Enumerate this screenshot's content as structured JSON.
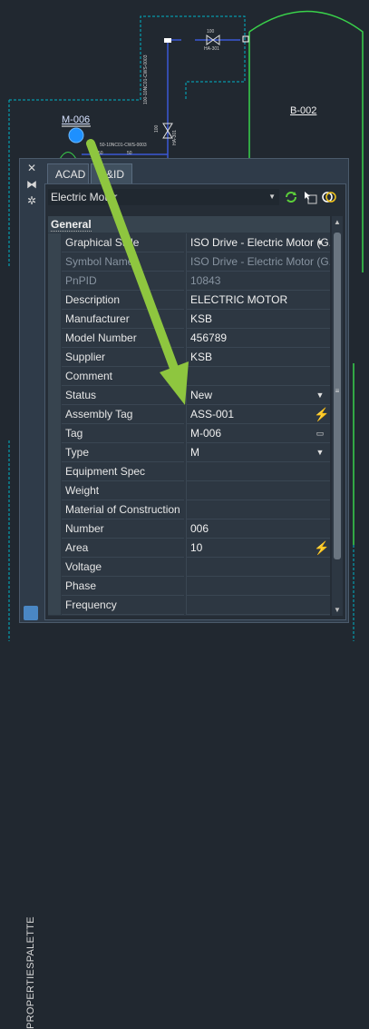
{
  "drawing": {
    "equipment_tag": "M-006",
    "vessel_tag": "B-002",
    "valve_tag": "HA-301",
    "valve_size": "100",
    "line_labels": [
      "50-10NC01-CWS-0003",
      "50",
      "50",
      "100-10NC01-CWS-0003",
      "100",
      "HA-301"
    ]
  },
  "palette": {
    "title": "PROPERTIESPALETTE",
    "tabs": [
      {
        "label": "ACAD"
      },
      {
        "label": "P&ID"
      }
    ],
    "object_type": "Electric Motor",
    "section": "General",
    "rows": [
      {
        "label": "Graphical Style",
        "value": "ISO Drive - Electric Motor (G...",
        "control": "dropdown",
        "dim": false
      },
      {
        "label": "Symbol Name",
        "value": "ISO Drive - Electric Motor (G...",
        "control": "",
        "dim": true
      },
      {
        "label": "PnPID",
        "value": "10843",
        "control": "",
        "dim": true
      },
      {
        "label": "Description",
        "value": "ELECTRIC MOTOR",
        "control": "",
        "dim": false
      },
      {
        "label": "Manufacturer",
        "value": "KSB",
        "control": "",
        "dim": false
      },
      {
        "label": "Model Number",
        "value": "456789",
        "control": "",
        "dim": false
      },
      {
        "label": "Supplier",
        "value": "KSB",
        "control": "",
        "dim": false
      },
      {
        "label": "Comment",
        "value": "",
        "control": "",
        "dim": false
      },
      {
        "label": "Status",
        "value": "New",
        "control": "dropdown",
        "dim": false
      },
      {
        "label": "Assembly Tag",
        "value": "ASS-001",
        "control": "lightning",
        "dim": false
      },
      {
        "label": "Tag",
        "value": "M-006",
        "control": "dialog",
        "dim": false
      },
      {
        "label": "Type",
        "value": "M",
        "control": "dropdown",
        "dim": false
      },
      {
        "label": "Equipment Spec",
        "value": "",
        "control": "",
        "dim": false
      },
      {
        "label": "Weight",
        "value": "",
        "control": "",
        "dim": false
      },
      {
        "label": "Material of Construction",
        "value": "",
        "control": "",
        "dim": false
      },
      {
        "label": "Number",
        "value": "006",
        "control": "",
        "dim": false
      },
      {
        "label": "Area",
        "value": "10",
        "control": "lightning",
        "dim": false
      },
      {
        "label": "Voltage",
        "value": "",
        "control": "",
        "dim": false
      },
      {
        "label": "Phase",
        "value": "",
        "control": "",
        "dim": false
      },
      {
        "label": "Frequency",
        "value": "",
        "control": "",
        "dim": false
      }
    ],
    "colors": {
      "accent_arrow": "#8ec63f",
      "lightning": "#f3c51b",
      "drawing_cyan": "#00b4c8",
      "drawing_green": "#39d14a"
    }
  }
}
